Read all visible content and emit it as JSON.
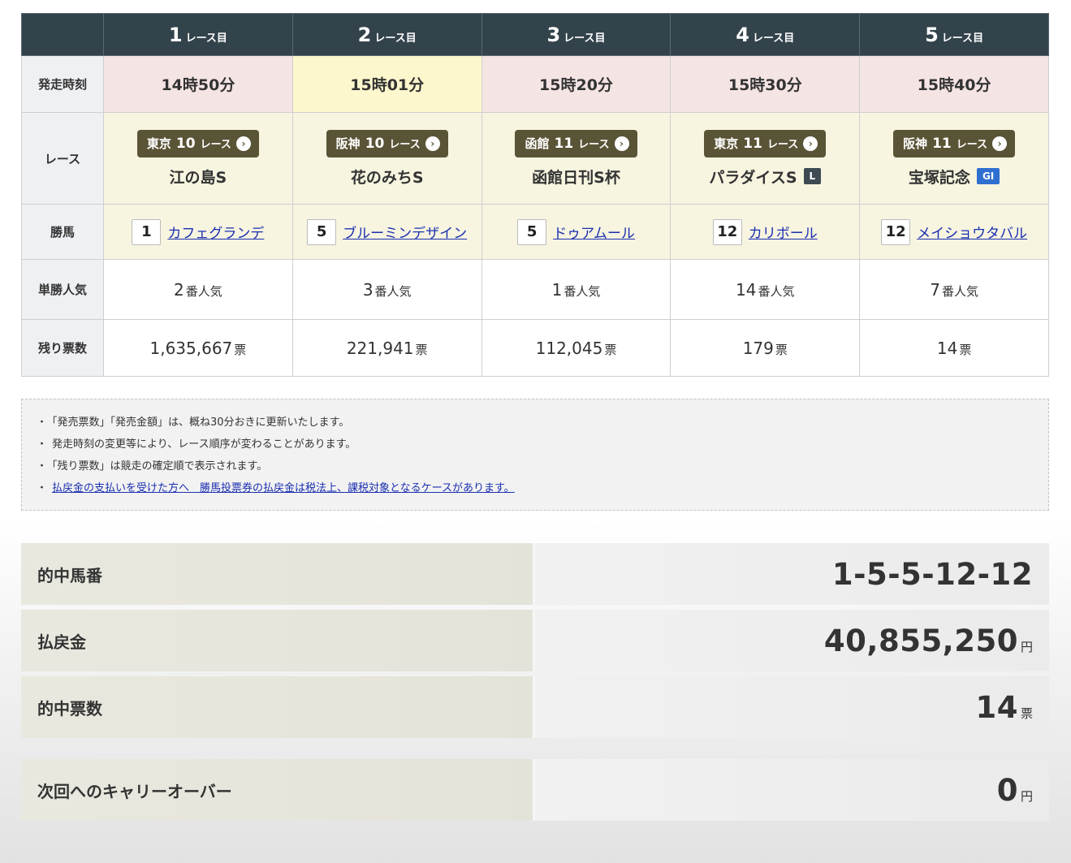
{
  "races": [
    {
      "num": "1",
      "suffix": "レース目",
      "start_time": "14時50分",
      "venue": "東京",
      "race_no": "10",
      "race_label": "レース",
      "name": "江の島S",
      "grade": "",
      "winner_num": "1",
      "winner_name": "カフェグランデ",
      "pop_num": "2",
      "pop_unit": "番人気",
      "remain": "1,635,667",
      "remain_unit": "票"
    },
    {
      "num": "2",
      "suffix": "レース目",
      "start_time": "15時01分",
      "venue": "阪神",
      "race_no": "10",
      "race_label": "レース",
      "name": "花のみちS",
      "grade": "",
      "winner_num": "5",
      "winner_name": "ブルーミンデザイン",
      "pop_num": "3",
      "pop_unit": "番人気",
      "remain": "221,941",
      "remain_unit": "票"
    },
    {
      "num": "3",
      "suffix": "レース目",
      "start_time": "15時20分",
      "venue": "函館",
      "race_no": "11",
      "race_label": "レース",
      "name": "函館日刊S杯",
      "grade": "",
      "winner_num": "5",
      "winner_name": "ドゥアムール",
      "pop_num": "1",
      "pop_unit": "番人気",
      "remain": "112,045",
      "remain_unit": "票"
    },
    {
      "num": "4",
      "suffix": "レース目",
      "start_time": "15時30分",
      "venue": "東京",
      "race_no": "11",
      "race_label": "レース",
      "name": "パラダイスS",
      "grade": "L",
      "grade_color": "#3d4a52",
      "winner_num": "12",
      "winner_name": "カリボール",
      "pop_num": "14",
      "pop_unit": "番人気",
      "remain": "179",
      "remain_unit": "票"
    },
    {
      "num": "5",
      "suffix": "レース目",
      "start_time": "15時40分",
      "venue": "阪神",
      "race_no": "11",
      "race_label": "レース",
      "name": "宝塚記念",
      "grade": "GI",
      "grade_color": "#2f6fd0",
      "winner_num": "12",
      "winner_name": "メイショウタバル",
      "pop_num": "7",
      "pop_unit": "番人気",
      "remain": "14",
      "remain_unit": "票"
    }
  ],
  "row_labels": {
    "start_time": "発走時刻",
    "race": "レース",
    "winner": "勝馬",
    "popularity": "単勝人気",
    "remaining": "残り票数"
  },
  "highlight_time_index": 1,
  "notes": [
    "「発売票数」「発売金額」は、概ね30分おきに更新いたします。",
    "発走時刻の変更等により、レース順序が変わることがあります。",
    "「残り票数」は競走の確定順で表示されます。"
  ],
  "notes_link": "払戻金の支払いを受けた方へ　勝馬投票券の払戻金は税法上、課税対象となるケースがあります。",
  "summary": {
    "hit_numbers_label": "的中馬番",
    "hit_numbers": "1-5-5-12-12",
    "payout_label": "払戻金",
    "payout": "40,855,250",
    "payout_unit": "円",
    "hit_tickets_label": "的中票数",
    "hit_tickets": "14",
    "hit_tickets_unit": "票",
    "carryover_label": "次回へのキャリーオーバー",
    "carryover": "0",
    "carryover_unit": "円"
  },
  "icons": {
    "venue_arrow": "arrow-right-circle-icon"
  }
}
